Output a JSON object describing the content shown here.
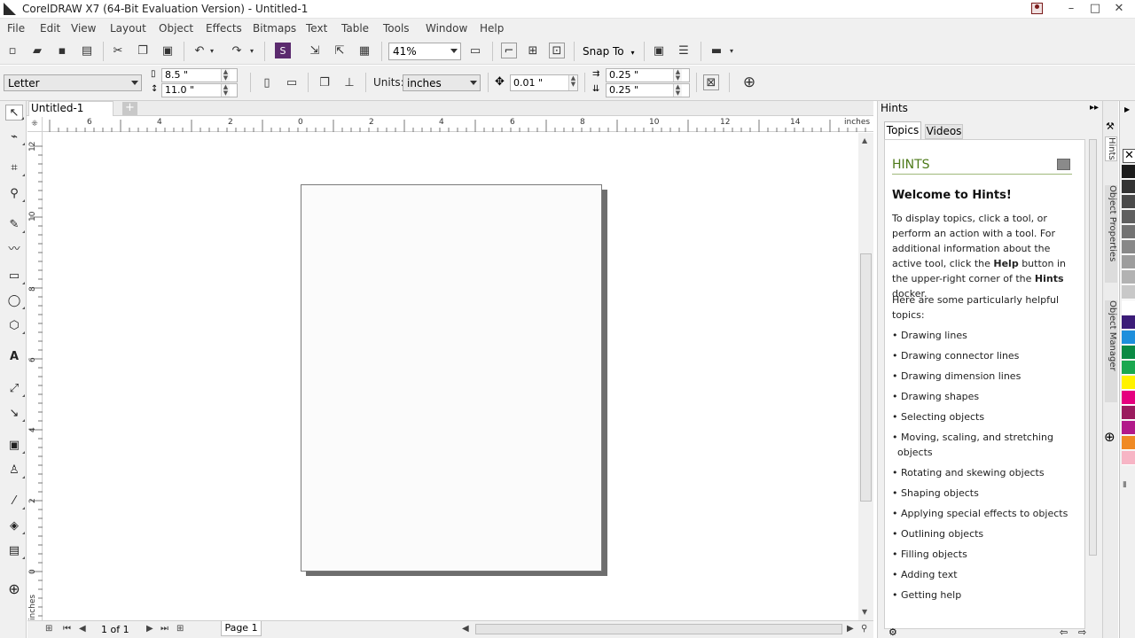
{
  "window": {
    "title": "CorelDRAW X7 (64-Bit Evaluation Version) - Untitled-1",
    "controls": [
      "–",
      "□",
      "✕"
    ]
  },
  "menu": [
    "File",
    "Edit",
    "View",
    "Layout",
    "Object",
    "Effects",
    "Bitmaps",
    "Text",
    "Table",
    "Tools",
    "Window",
    "Help"
  ],
  "toolbar": {
    "zoom_value": "41%",
    "snap_to_label": "Snap To"
  },
  "property_bar": {
    "page_size": "Letter",
    "width": "8.5 \"",
    "height": "11.0 \"",
    "units_label": "Units:",
    "units_value": "inches",
    "nudge": "0.01 \"",
    "dup_x": "0.25 \"",
    "dup_y": "0.25 \""
  },
  "document": {
    "tab_label": "Untitled-1",
    "new_tab": "+",
    "ruler_unit": "inches",
    "h_ruler_labels": [
      "6",
      "4",
      "2",
      "0",
      "2",
      "4",
      "6",
      "8",
      "10",
      "12",
      "14"
    ],
    "v_ruler_labels": [
      "12",
      "10",
      "8",
      "6",
      "4",
      "2",
      "0"
    ],
    "v_ruler_unit": "inches"
  },
  "page_nav": {
    "page_count": "1 of 1",
    "page_tab": "Page 1"
  },
  "hints": {
    "docker_title": "Hints",
    "tab_topics": "Topics",
    "tab_videos": "Videos",
    "heading": "HINTS",
    "welcome": "Welcome to Hints!",
    "intro_before_help": "To display topics, click a tool, or perform an action with a tool. For additional information about the active tool, click the ",
    "help_word": "Help",
    "intro_middle": " button in the upper-right corner of the ",
    "hints_word": "Hints",
    "intro_after": " docker.",
    "subtitle": "Here are some particularly helpful topics:",
    "topics": [
      "Drawing lines",
      "Drawing connector lines",
      "Drawing dimension lines",
      "Drawing shapes",
      "Selecting objects",
      "Moving, scaling, and stretching objects",
      "Rotating and skewing objects",
      "Shaping objects",
      "Applying special effects to objects",
      "Outlining objects",
      "Filling objects",
      "Adding text",
      "Getting help"
    ]
  },
  "docker_tabs": [
    "Hints",
    "Object Properties",
    "Object Manager"
  ],
  "palette": {
    "colors": [
      "#1b1b1b",
      "#333333",
      "#4a4a4a",
      "#5f5f5f",
      "#737373",
      "#888888",
      "#9d9d9d",
      "#b2b2b2",
      "#c8c8c8",
      "#ffffff",
      "#3b1c78",
      "#1e8fdc",
      "#0b8a44",
      "#1aa84f",
      "#fff200",
      "#e5007e",
      "#9b1b5e",
      "#b2198a",
      "#f08a24",
      "#f7b5c5"
    ]
  }
}
